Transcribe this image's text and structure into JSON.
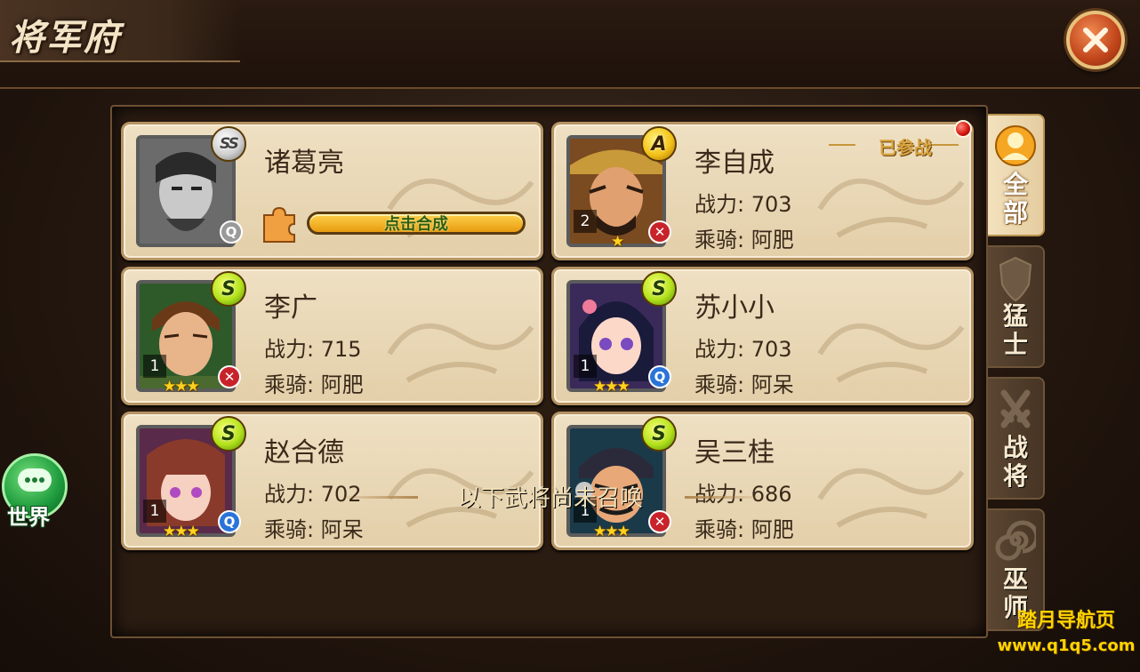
{
  "header": {
    "title": "将军府"
  },
  "close_icon": "close-x-icon",
  "heroes": [
    {
      "name": "诸葛亮",
      "rank": "SS",
      "greyed": true,
      "action_label": "点击合成"
    },
    {
      "name": "李自成",
      "rank": "A",
      "level": "2",
      "stars": 1,
      "power_label": "战力:",
      "power": "703",
      "mount_label": "乘骑:",
      "mount": "阿肥",
      "type": "red",
      "joined_label": "已参战",
      "has_notice": true
    },
    {
      "name": "李广",
      "rank": "S",
      "level": "1",
      "stars": 3,
      "power_label": "战力:",
      "power": "715",
      "mount_label": "乘骑:",
      "mount": "阿肥",
      "type": "red"
    },
    {
      "name": "苏小小",
      "rank": "S",
      "level": "1",
      "stars": 3,
      "power_label": "战力:",
      "power": "703",
      "mount_label": "乘骑:",
      "mount": "阿呆",
      "type": "blue"
    },
    {
      "name": "赵合德",
      "rank": "S",
      "level": "1",
      "stars": 3,
      "power_label": "战力:",
      "power": "702",
      "mount_label": "乘骑:",
      "mount": "阿呆",
      "type": "blue"
    },
    {
      "name": "吴三桂",
      "rank": "S",
      "level": "1",
      "stars": 3,
      "power_label": "战力:",
      "power": "686",
      "mount_label": "乘骑:",
      "mount": "阿肥",
      "type": "red"
    }
  ],
  "footer_text": "以下武将尚未召唤",
  "tabs": [
    {
      "label_line1": "全",
      "label_line2": "部",
      "active": true,
      "icon": "person-icon"
    },
    {
      "label_line1": "猛",
      "label_line2": "士",
      "active": false,
      "icon": "shield-icon"
    },
    {
      "label_line1": "战",
      "label_line2": "将",
      "active": false,
      "icon": "sword-icon"
    },
    {
      "label_line1": "巫",
      "label_line2": "师",
      "active": false,
      "icon": "spiral-icon"
    }
  ],
  "world_chat": {
    "label": "世界",
    "icon": "chat-bubble-icon"
  },
  "watermark": {
    "line1": "踏月导航页",
    "line2": "www.q1q5.com"
  },
  "colors": {
    "accent_gold": "#f3c21a",
    "rank_s_green": "#b4e21e",
    "panel_brown": "#2b1c12",
    "card_parchment": "#efe0c3"
  }
}
